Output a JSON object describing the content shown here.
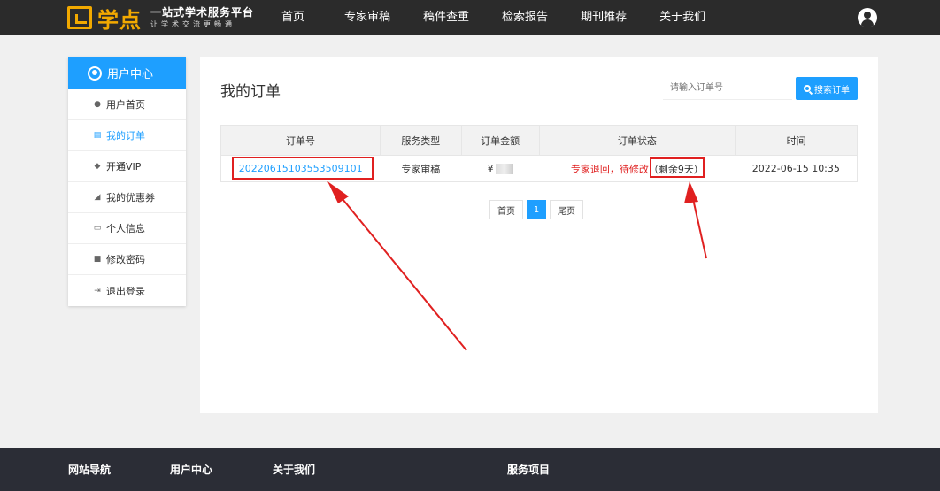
{
  "header": {
    "logo_name": "学点",
    "logo_slogan": "一站式学术服务平台",
    "logo_subslogan": "让学术交流更畅通",
    "nav": [
      "首页",
      "专家审稿",
      "稿件查重",
      "检索报告",
      "期刊推荐",
      "关于我们"
    ],
    "user_icon": "user-circle-icon"
  },
  "sidebar": {
    "title": "用户中心",
    "items": [
      {
        "label": "用户首页",
        "icon": "user-icon"
      },
      {
        "label": "我的订单",
        "icon": "document-icon"
      },
      {
        "label": "开通VIP",
        "icon": "diamond-icon"
      },
      {
        "label": "我的优惠券",
        "icon": "tag-icon"
      },
      {
        "label": "个人信息",
        "icon": "id-card-icon"
      },
      {
        "label": "修改密码",
        "icon": "lock-icon"
      },
      {
        "label": "退出登录",
        "icon": "logout-icon"
      }
    ],
    "active_index": 1
  },
  "main": {
    "title": "我的订单",
    "search": {
      "placeholder": "请输入订单号",
      "button_label": "搜索订单"
    },
    "table": {
      "headers": [
        "订单号",
        "服务类型",
        "订单金额",
        "订单状态",
        "时间"
      ],
      "rows": [
        {
          "order_no": "20220615103553509101",
          "service": "专家审稿",
          "amount_prefix": "¥",
          "status": "专家退回，待修改",
          "remaining": "（剩余9天）",
          "time": "2022-06-15 10:35"
        }
      ]
    },
    "pager": {
      "first": "首页",
      "current": "1",
      "last": "尾页"
    }
  },
  "footer": {
    "cols": [
      "网站导航",
      "用户中心",
      "关于我们",
      "服务项目"
    ]
  },
  "colors": {
    "accent": "#1e9fff",
    "annotation": "#e02020",
    "brand": "#f2a900"
  }
}
